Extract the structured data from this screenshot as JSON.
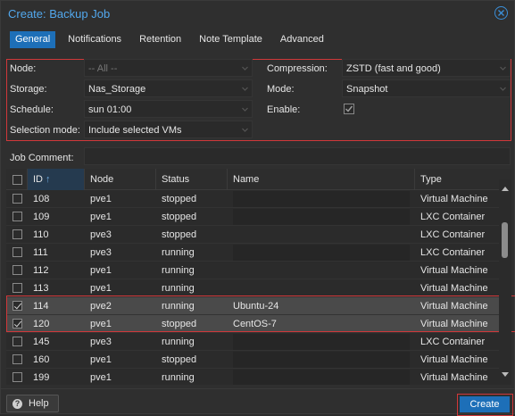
{
  "window": {
    "title": "Create: Backup Job"
  },
  "tabs": [
    "General",
    "Notifications",
    "Retention",
    "Note Template",
    "Advanced"
  ],
  "form": {
    "node": {
      "label": "Node:",
      "value": "-- All --"
    },
    "storage": {
      "label": "Storage:",
      "value": "Nas_Storage"
    },
    "schedule": {
      "label": "Schedule:",
      "value": "sun 01:00"
    },
    "selection_mode": {
      "label": "Selection mode:",
      "value": "Include selected VMs"
    },
    "compression": {
      "label": "Compression:",
      "value": "ZSTD (fast and good)"
    },
    "mode": {
      "label": "Mode:",
      "value": "Snapshot"
    },
    "enable": {
      "label": "Enable:",
      "checked": true
    },
    "job_comment": {
      "label": "Job Comment:",
      "value": ""
    }
  },
  "grid": {
    "columns": [
      "ID",
      "Node",
      "Status",
      "Name",
      "Type"
    ],
    "sort_indicator": "↑",
    "rows": [
      {
        "id": "108",
        "node": "pve1",
        "status": "stopped",
        "name": "",
        "type": "Virtual Machine",
        "checked": false
      },
      {
        "id": "109",
        "node": "pve1",
        "status": "stopped",
        "name": "",
        "type": "LXC Container",
        "checked": false
      },
      {
        "id": "110",
        "node": "pve3",
        "status": "stopped",
        "name": "",
        "type": "LXC Container",
        "checked": false
      },
      {
        "id": "111",
        "node": "pve3",
        "status": "running",
        "name": "",
        "type": "LXC Container",
        "checked": false
      },
      {
        "id": "112",
        "node": "pve1",
        "status": "running",
        "name": "",
        "type": "Virtual Machine",
        "checked": false
      },
      {
        "id": "113",
        "node": "pve1",
        "status": "running",
        "name": "",
        "type": "Virtual Machine",
        "checked": false
      },
      {
        "id": "114",
        "node": "pve2",
        "status": "running",
        "name": "Ubuntu-24",
        "type": "Virtual Machine",
        "checked": true
      },
      {
        "id": "120",
        "node": "pve1",
        "status": "stopped",
        "name": "CentOS-7",
        "type": "Virtual Machine",
        "checked": true
      },
      {
        "id": "145",
        "node": "pve3",
        "status": "running",
        "name": "",
        "type": "LXC Container",
        "checked": false
      },
      {
        "id": "160",
        "node": "pve1",
        "status": "stopped",
        "name": "",
        "type": "Virtual Machine",
        "checked": false
      },
      {
        "id": "199",
        "node": "pve1",
        "status": "running",
        "name": "",
        "type": "Virtual Machine",
        "checked": false
      }
    ]
  },
  "footer": {
    "help_label": "Help",
    "help_icon": "?",
    "create_label": "Create"
  },
  "colors": {
    "accent": "#1d6fb8",
    "title": "#52a8ee",
    "highlight": "#d0383a"
  }
}
